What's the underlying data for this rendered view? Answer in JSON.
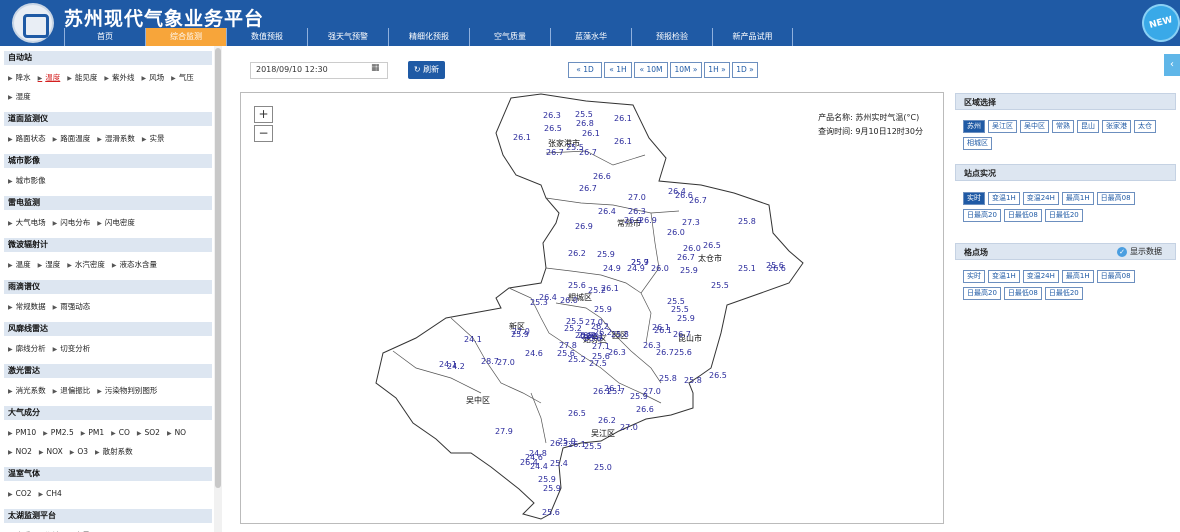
{
  "header": {
    "title": "苏州现代气象业务平台",
    "new_badge": "NEW",
    "nav": [
      {
        "label": "首页",
        "active": false
      },
      {
        "label": "综合监测",
        "active": true
      },
      {
        "label": "数值预报",
        "active": false
      },
      {
        "label": "强天气预警",
        "active": false
      },
      {
        "label": "精细化预报",
        "active": false
      },
      {
        "label": "空气质量",
        "active": false
      },
      {
        "label": "蓝藻水华",
        "active": false
      },
      {
        "label": "预报检验",
        "active": false
      },
      {
        "label": "新产品试用",
        "active": false
      }
    ]
  },
  "sidebar": {
    "sections": [
      {
        "title": "自动站",
        "items": [
          "降水",
          "温度",
          "能见度",
          "紫外线",
          "风场",
          "气压",
          "湿度"
        ],
        "active_item": "温度"
      },
      {
        "title": "道面监测仪",
        "items": [
          "路面状态",
          "路面温度",
          "湿滑系数",
          "实景"
        ]
      },
      {
        "title": "城市影像",
        "items": [
          "城市影像"
        ]
      },
      {
        "title": "雷电监测",
        "items": [
          "大气电场",
          "闪电分布",
          "闪电密度"
        ]
      },
      {
        "title": "微波辐射计",
        "items": [
          "温度",
          "湿度",
          "水汽密度",
          "液态水含量"
        ]
      },
      {
        "title": "雨滴谱仪",
        "items": [
          "常规数据",
          "雨强动态"
        ]
      },
      {
        "title": "风廓线雷达",
        "items": [
          "廓线分析",
          "切变分析"
        ]
      },
      {
        "title": "激光雷达",
        "items": [
          "消光系数",
          "退偏振比",
          "污染物判别图形"
        ]
      },
      {
        "title": "大气成分",
        "items": [
          "PM10",
          "PM2.5",
          "PM1",
          "CO",
          "SO2",
          "NO",
          "NO2",
          "NOX",
          "O3",
          "散射系数"
        ]
      },
      {
        "title": "温室气体",
        "items": [
          "CO2",
          "CH4"
        ]
      },
      {
        "title": "太湖监测平台",
        "items": [
          "水质",
          "湖流",
          "实景"
        ]
      }
    ]
  },
  "toolbar": {
    "datetime": "2018/09/10 12:30",
    "refresh_label": "刷新",
    "time_buttons": [
      "« 1D",
      "« 1H",
      "« 10M",
      "10M »",
      "1H »",
      "1D »"
    ]
  },
  "map": {
    "product_name": "产品名称: 苏州实时气温(°C)",
    "query_time": "查询时间: 9月10日12时30分",
    "zoom_in": "+",
    "zoom_out": "−",
    "places": [
      "张家港市",
      "常熟市",
      "太仓市",
      "相城区",
      "新区",
      "姑苏区",
      "园区",
      "昆山市",
      "吴中区",
      "吴江区"
    ],
    "values": [
      "25.5",
      "26.3",
      "26.8",
      "26.1",
      "26.1",
      "26.5",
      "26.1",
      "26.1",
      "26.7",
      "25.5",
      "26.7",
      "26.6",
      "26.7",
      "26.4",
      "27.0",
      "26.6",
      "26.3",
      "26.7",
      "27.3",
      "26.4",
      "26.9",
      "26.9",
      "26.9",
      "26.0",
      "25.8",
      "25.9",
      "26.5",
      "26.2",
      "26.0",
      "25.7",
      "26.7",
      "25.6",
      "24.9",
      "24.9",
      "25.9",
      "25.1",
      "25.9",
      "26.0",
      "26.6",
      "25.6",
      "25.2",
      "25.5",
      "25.5",
      "26.4",
      "25.3",
      "26.0",
      "26.1",
      "25.9",
      "25.5",
      "25.9",
      "25.5",
      "25.2",
      "27.0",
      "26.2",
      "26.2",
      "26.8",
      "26.1",
      "25.6",
      "24.1",
      "27.0",
      "25.9",
      "26.5",
      "25.8",
      "26.1",
      "24.2",
      "28.7",
      "24.6",
      "27.8",
      "25.6",
      "26.5",
      "26.3",
      "26.7",
      "25.6",
      "26.1",
      "24.1",
      "26.3",
      "27.1",
      "25.2",
      "26.7",
      "25.8",
      "26.1",
      "27.0",
      "25.6",
      "27.5",
      "26.5",
      "26.1",
      "25.7",
      "27.0",
      "25.8",
      "25.9",
      "26.6",
      "26.5",
      "27.9",
      "26.2",
      "27.0",
      "25.9",
      "24.8",
      "26.4",
      "26.1",
      "25.5",
      "26.3",
      "24.6",
      "24.4",
      "25.4",
      "25.0",
      "25.9",
      "25.9",
      "25.6"
    ]
  },
  "right_panel": {
    "region": {
      "title": "区域选择",
      "buttons": [
        "苏州",
        "吴江区",
        "吴中区",
        "常熟",
        "昆山",
        "张家港",
        "太仓",
        "相城区"
      ],
      "active": "苏州"
    },
    "station": {
      "title": "站点实况",
      "buttons": [
        "实时",
        "变温1H",
        "变温24H",
        "最高1H",
        "日最高08",
        "日最高20",
        "日最低08",
        "日最低20"
      ],
      "active": "实时"
    },
    "grid": {
      "title": "格点场",
      "show_data": "显示数据",
      "buttons": [
        "实时",
        "变温1H",
        "变温24H",
        "最高1H",
        "日最高08",
        "日最高20",
        "日最低08",
        "日最低20"
      ]
    }
  },
  "colors": {
    "header": "#1f5aa5",
    "nav_active": "#f7a53a",
    "value_text": "#2b2b9c",
    "section_bg": "#dde6f1"
  }
}
